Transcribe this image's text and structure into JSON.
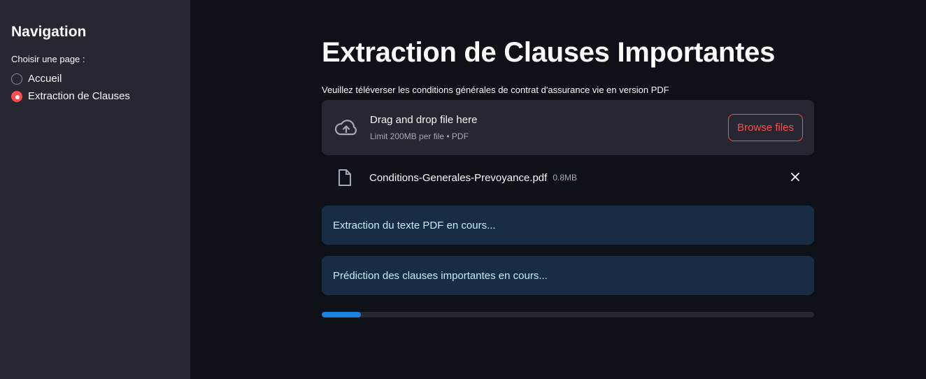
{
  "sidebar": {
    "title": "Navigation",
    "radio_label": "Choisir une page :",
    "options": [
      {
        "label": "Accueil",
        "selected": false
      },
      {
        "label": "Extraction de Clauses",
        "selected": true
      }
    ]
  },
  "main": {
    "title": "Extraction de Clauses Importantes",
    "uploader": {
      "label": "Veuillez téléverser les conditions générales de contrat d'assurance vie en version PDF",
      "drop_text": "Drag and drop file here",
      "limit_text": "Limit 200MB per file • PDF",
      "browse_label": "Browse files",
      "icon": "cloud-upload-icon"
    },
    "file": {
      "name": "Conditions-Generales-Prevoyance.pdf",
      "size": "0.8MB",
      "icon": "file-icon"
    },
    "status_messages": [
      "Extraction du texte PDF en cours...",
      "Prédiction des clauses importantes en cours..."
    ],
    "progress": 0.08
  },
  "colors": {
    "accent": "#ff4b4b",
    "progress": "#1c83e1",
    "info_bg": "#172d43",
    "info_text": "#c7ebff",
    "sidebar_bg": "#262730",
    "app_bg": "#0e1117"
  }
}
